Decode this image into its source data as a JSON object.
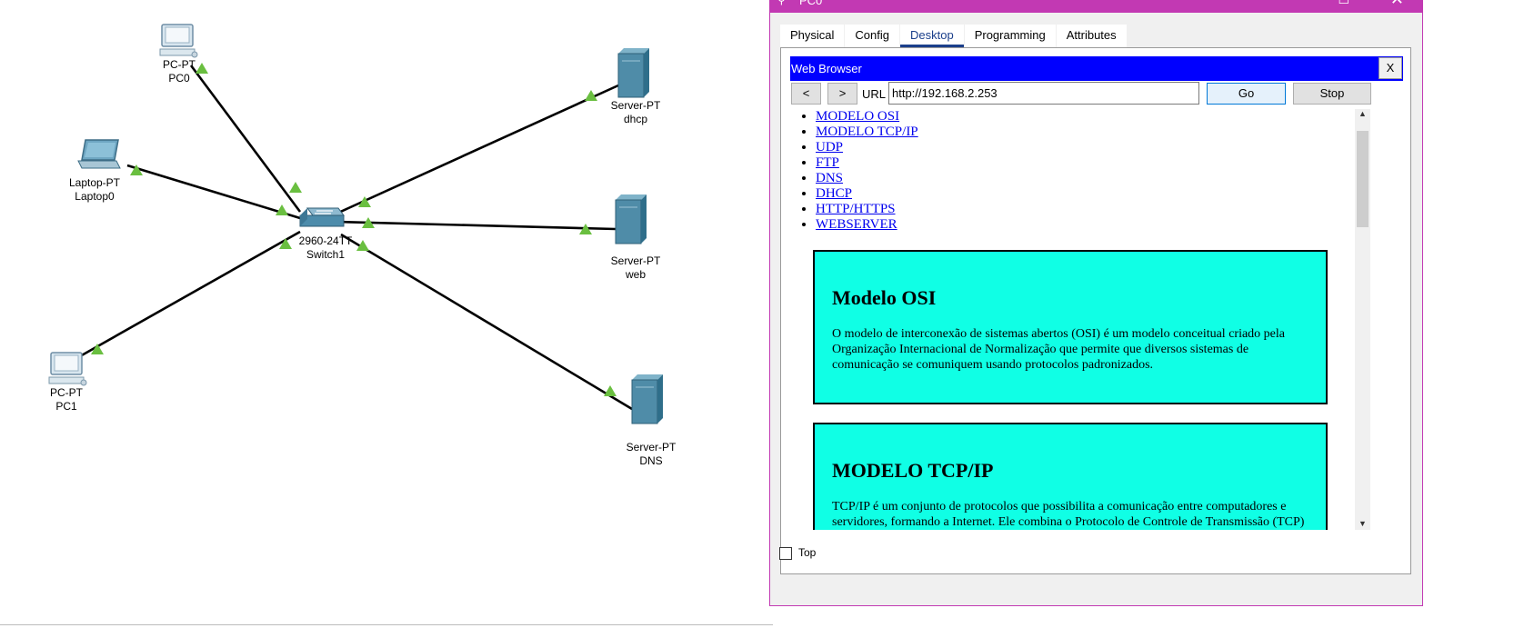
{
  "topology": {
    "nodes": [
      {
        "id": "pc0",
        "type_label": "PC-PT",
        "name_label": "PC0"
      },
      {
        "id": "laptop0",
        "type_label": "Laptop-PT",
        "name_label": "Laptop0"
      },
      {
        "id": "pc1",
        "type_label": "PC-PT",
        "name_label": "PC1"
      },
      {
        "id": "switch1",
        "type_label": "2960-24TT",
        "name_label": "Switch1"
      },
      {
        "id": "dhcp",
        "type_label": "Server-PT",
        "name_label": "dhcp"
      },
      {
        "id": "web",
        "type_label": "Server-PT",
        "name_label": "web"
      },
      {
        "id": "dns",
        "type_label": "Server-PT",
        "name_label": "DNS"
      }
    ],
    "links": [
      {
        "from": "pc0",
        "to": "switch1"
      },
      {
        "from": "laptop0",
        "to": "switch1"
      },
      {
        "from": "pc1",
        "to": "switch1"
      },
      {
        "from": "dhcp",
        "to": "switch1"
      },
      {
        "from": "web",
        "to": "switch1"
      },
      {
        "from": "dns",
        "to": "switch1"
      }
    ],
    "link_status_color": "#6abf40"
  },
  "window": {
    "title": "PC0",
    "icons": {
      "left": "search-icon",
      "max": "maximize-icon",
      "close": "close-icon"
    },
    "accent_color": "#c239b3",
    "tabs": [
      {
        "label": "Physical",
        "active": false
      },
      {
        "label": "Config",
        "active": false
      },
      {
        "label": "Desktop",
        "active": true
      },
      {
        "label": "Programming",
        "active": false
      },
      {
        "label": "Attributes",
        "active": false
      }
    ],
    "top_checkbox_label": "Top"
  },
  "browser": {
    "title": "Web Browser",
    "close_label": "X",
    "back_label": "<",
    "forward_label": ">",
    "url_label": "URL",
    "url_value": "http://192.168.2.253",
    "go_label": "Go",
    "stop_label": "Stop",
    "title_color": "#0000ff"
  },
  "page": {
    "toc": [
      "MODELO OSI",
      "MODELO TCP/IP",
      "UDP",
      "FTP",
      "DNS",
      "DHCP",
      "HTTP/HTTPS",
      "WEBSERVER"
    ],
    "sections": [
      {
        "heading": "Modelo OSI",
        "body": "O modelo de interconexão de sistemas abertos (OSI) é um modelo conceitual criado pela Organização Internacional de Normalização que permite que diversos sistemas de comunicação se comuniquem usando protocolos padronizados."
      },
      {
        "heading": "MODELO TCP/IP",
        "body": "TCP/IP é um conjunto de protocolos que possibilita a comunicação entre computadores e servidores, formando a Internet. Ele combina o Protocolo de Controle de Transmissão (TCP) com o Protocolo de Internet (IP) para permitir a transmissão de dados."
      }
    ],
    "section_color": "#10ffe5"
  }
}
